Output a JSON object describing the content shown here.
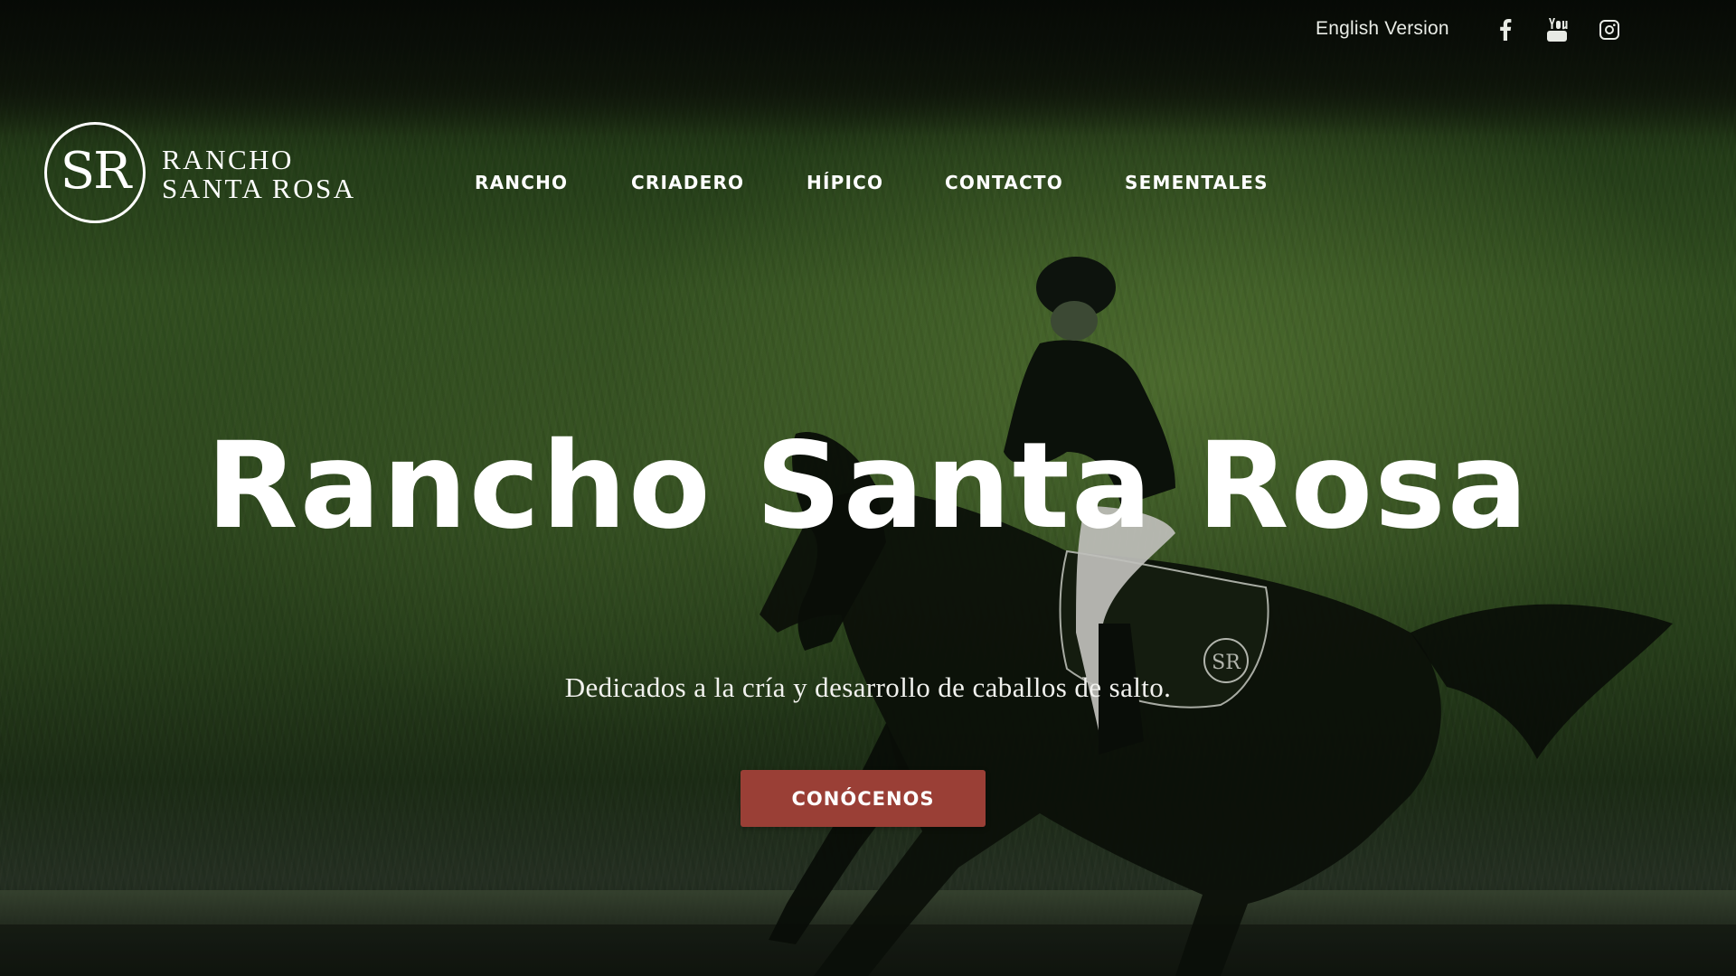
{
  "topbar": {
    "language_link": "English Version",
    "social_icons": [
      "facebook-icon",
      "youtube-icon",
      "instagram-icon"
    ]
  },
  "logo": {
    "monogram": "SR",
    "line1": "RANCHO",
    "line2": "SANTA ROSA"
  },
  "nav": {
    "items": [
      {
        "label": "RANCHO"
      },
      {
        "label": "CRIADERO"
      },
      {
        "label": "HÍPICO"
      },
      {
        "label": "CONTACTO"
      },
      {
        "label": "SEMENTALES"
      }
    ]
  },
  "hero": {
    "title": "Rancho Santa Rosa",
    "subtitle": "Dedicados a la cría y desarrollo de caballos de salto.",
    "cta_label": "CONÓCENOS",
    "saddle_pad_monogram": "SR"
  },
  "colors": {
    "cta_background": "#9a3f36",
    "text": "#ffffff",
    "background_green": "#3a5a26"
  }
}
